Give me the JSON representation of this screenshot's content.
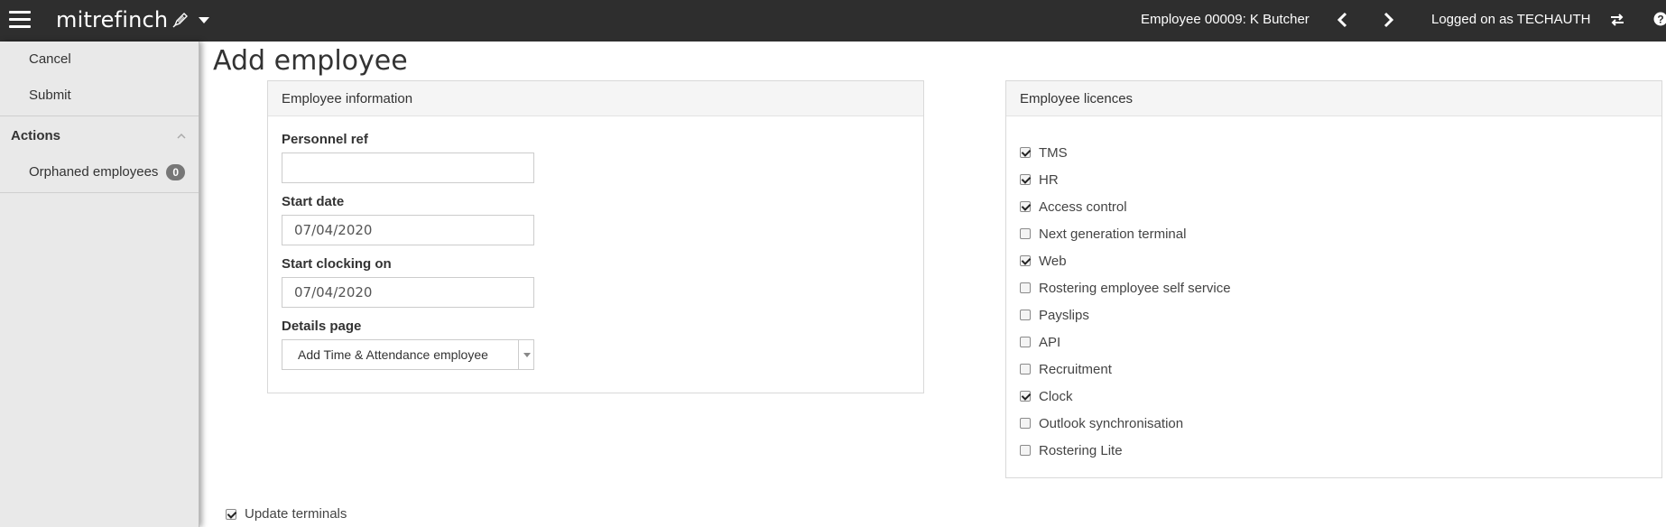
{
  "topbar": {
    "brand": "mitrefinch",
    "employee_title": "Employee 00009: K Butcher",
    "logged_on": "Logged on as TECHAUTH",
    "icons": [
      "hamburger-icon",
      "pen-icon",
      "caret-down-icon",
      "chevron-left-icon",
      "chevron-right-icon",
      "swap-icon",
      "help-icon"
    ]
  },
  "sidebar": {
    "cancel": "Cancel",
    "submit": "Submit",
    "actions_title": "Actions",
    "orphaned_label": "Orphaned employees",
    "orphaned_count": "0"
  },
  "page": {
    "title": "Add employee"
  },
  "info": {
    "heading": "Employee information",
    "personnel_ref_label": "Personnel ref",
    "personnel_ref_value": "",
    "start_date_label": "Start date",
    "start_date_value": "07/04/2020",
    "start_clocking_label": "Start clocking on",
    "start_clocking_value": "07/04/2020",
    "details_page_label": "Details page",
    "details_page_value": "Add Time & Attendance employee"
  },
  "licences": {
    "heading": "Employee licences",
    "items": [
      {
        "label": "TMS",
        "checked": true
      },
      {
        "label": "HR",
        "checked": true
      },
      {
        "label": "Access control",
        "checked": true
      },
      {
        "label": "Next generation terminal",
        "checked": false
      },
      {
        "label": "Web",
        "checked": true
      },
      {
        "label": "Rostering employee self service",
        "checked": false
      },
      {
        "label": "Payslips",
        "checked": false
      },
      {
        "label": "API",
        "checked": false
      },
      {
        "label": "Recruitment",
        "checked": false
      },
      {
        "label": "Clock",
        "checked": true
      },
      {
        "label": "Outlook synchronisation",
        "checked": false
      },
      {
        "label": "Rostering Lite",
        "checked": false
      }
    ]
  },
  "footer": {
    "update_terminals_label": "Update terminals",
    "update_terminals_checked": true
  }
}
